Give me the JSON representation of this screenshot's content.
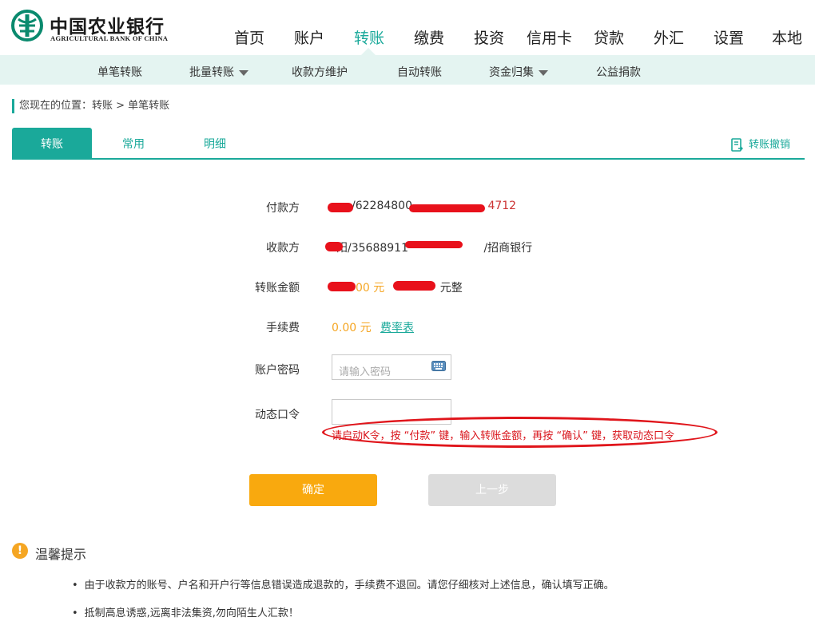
{
  "header": {
    "bank_name_cn": "中国农业银行",
    "bank_name_en": "AGRICULTURAL BANK OF CHINA",
    "nav": [
      "首页",
      "账户",
      "转账",
      "缴费",
      "投资",
      "信用卡",
      "贷款",
      "外汇",
      "设置",
      "本地"
    ],
    "active_nav": "转账"
  },
  "subnav": [
    "单笔转账",
    "批量转账",
    "收款方维护",
    "自动转账",
    "资金归集",
    "公益捐款"
  ],
  "breadcrumb": "您现在的位置：转账 > 单笔转账",
  "tabs": [
    "转账",
    "常用",
    "明细"
  ],
  "revoke_label": "转账撤销",
  "form": {
    "payer_label": "付款方",
    "payer_value_visible": "/62284800",
    "payer_value_tail": "4712",
    "payee_label": "收款方",
    "payee_value_visible": "阳/35688911",
    "payee_bank": "/招商银行",
    "amount_label": "转账金额",
    "amount_num": "00 元",
    "amount_words": "元整",
    "fee_label": "手续费",
    "fee_value": "0.00 元",
    "fee_link": "费率表",
    "password_label": "账户密码",
    "password_placeholder": "请输入密码",
    "otp_label": "动态口令",
    "otp_hint": "请启动K令，按 “付款” 键，输入转账金额，再按 “确认” 键，获取动态口令"
  },
  "buttons": {
    "ok": "确定",
    "back": "上一步"
  },
  "tips": {
    "title": "温馨提示",
    "items": [
      "由于收款方的账号、户名和开户行等信息错误造成退款的，手续费不退回。请您仔细核对上述信息，确认填写正确。",
      "抵制高息诱惑,远离非法集资,勿向陌生人汇款！"
    ]
  },
  "colors": {
    "brand": "#1aa99a",
    "accent": "#f9a90e",
    "warning": "#e0151b",
    "disabled": "#dcdcdc"
  }
}
